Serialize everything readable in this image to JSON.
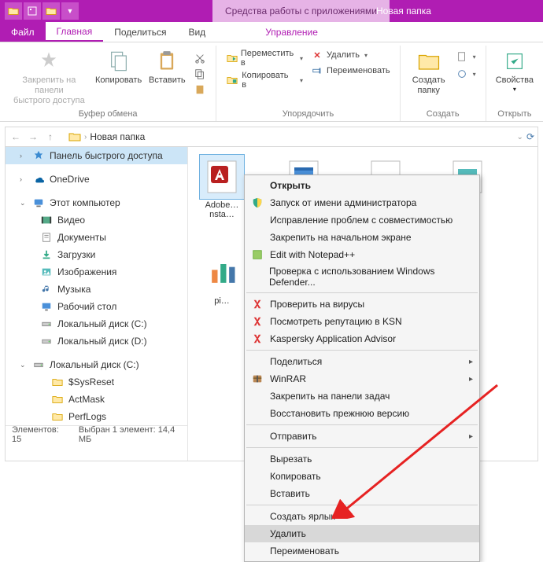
{
  "titlebar": {
    "context_tab": "Средства работы с приложениями",
    "window_title": "Новая папка"
  },
  "tabs": {
    "file": "Файл",
    "home": "Главная",
    "share": "Поделиться",
    "view": "Вид",
    "manage": "Управление"
  },
  "ribbon": {
    "pin": "Закрепить на панели\nбыстрого доступа",
    "copy": "Копировать",
    "paste": "Вставить",
    "clipboard_group": "Буфер обмена",
    "move_to": "Переместить в",
    "copy_to": "Копировать в",
    "delete": "Удалить",
    "rename": "Переименовать",
    "organize_group": "Упорядочить",
    "new_folder": "Создать\nпапку",
    "new_group": "Создать",
    "properties": "Свойства",
    "open_group": "Открыть"
  },
  "breadcrumb": {
    "segment": "Новая папка"
  },
  "sidebar": {
    "quick_access": "Панель быстрого доступа",
    "onedrive": "OneDrive",
    "this_pc": "Этот компьютер",
    "videos": "Видео",
    "documents": "Документы",
    "downloads": "Загрузки",
    "pictures": "Изображения",
    "music": "Музыка",
    "desktop": "Рабочий стол",
    "local_c": "Локальный диск (C:)",
    "local_d": "Локальный диск (D:)",
    "local_c2": "Локальный диск (C:)",
    "sysreset": "$SysReset",
    "actmask": "ActMask",
    "perflogs": "PerfLogs"
  },
  "files": {
    "item1": "Adobe…\nnsta…"
  },
  "status": {
    "count": "Элементов: 15",
    "selection": "Выбран 1 элемент: 14,4 МБ"
  },
  "context_menu": {
    "open": "Открыть",
    "run_as_admin": "Запуск от имени администратора",
    "troubleshoot": "Исправление проблем с совместимостью",
    "pin_start": "Закрепить на начальном экране",
    "edit_npp": "Edit with Notepad++",
    "defender": "Проверка с использованием Windows Defender...",
    "scan_virus": "Проверить на вирусы",
    "ksn": "Посмотреть репутацию в KSN",
    "kaspersky": "Kaspersky Application Advisor",
    "share": "Поделиться",
    "winrar": "WinRAR",
    "pin_taskbar": "Закрепить на панели задач",
    "restore": "Восстановить прежнюю версию",
    "send_to": "Отправить",
    "cut": "Вырезать",
    "copy": "Копировать",
    "paste": "Вставить",
    "shortcut": "Создать ярлык",
    "delete": "Удалить",
    "rename": "Переименовать"
  }
}
